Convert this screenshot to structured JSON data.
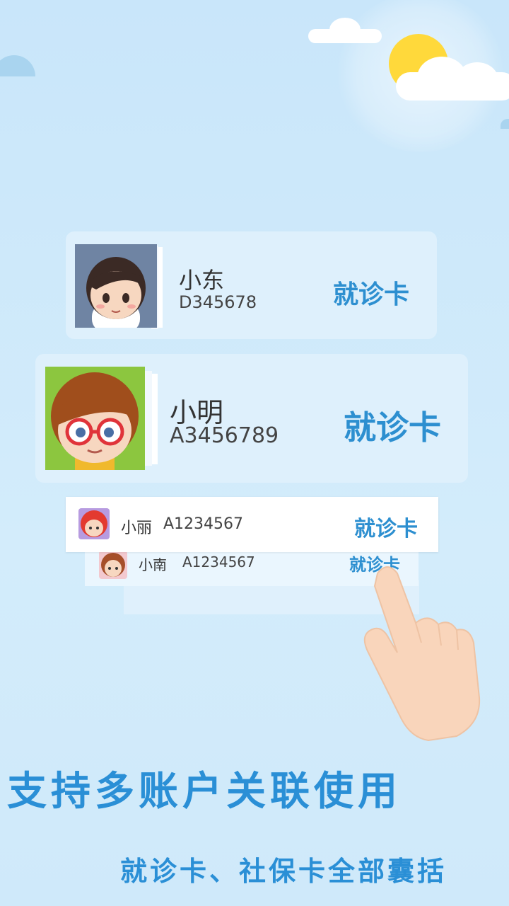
{
  "cards": [
    {
      "name": "小东",
      "id": "D345678",
      "label": "就诊卡"
    },
    {
      "name": "小明",
      "id": "A3456789",
      "label": "就诊卡"
    },
    {
      "name": "小丽",
      "id": "A1234567",
      "label": "就诊卡"
    },
    {
      "name": "小南",
      "id": "A1234567",
      "label": "就诊卡"
    }
  ],
  "headline": "支持多账户关联使用",
  "subline": "就诊卡、社保卡全部囊括",
  "colors": {
    "accent": "#2a8fd6",
    "sky": "#c9e6fa",
    "sun": "#ffd93b"
  }
}
